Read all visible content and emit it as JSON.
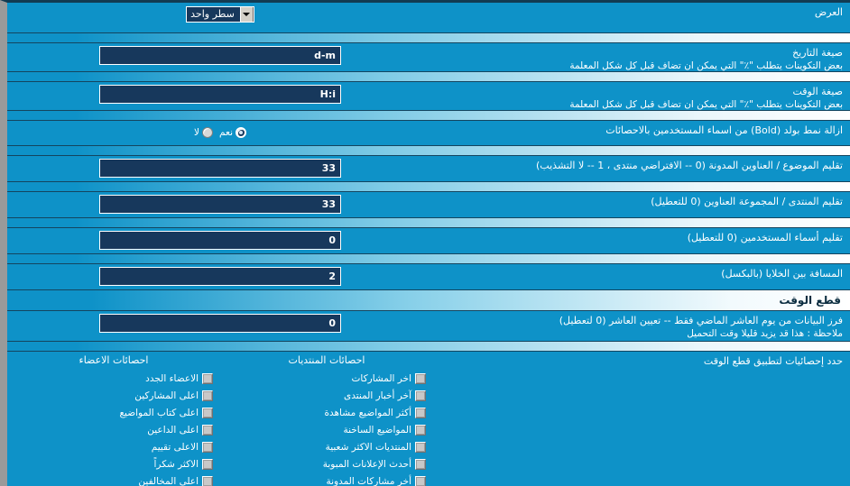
{
  "theme": {
    "body_bg": "#0e92c8",
    "input_bg": "#17385c",
    "input_border": "#ffffff",
    "divider_light": "#ffffff",
    "text": "#ffffff",
    "header_text": "#0b2d40",
    "left_border": "#9a9a9a"
  },
  "rows": [
    {
      "label": "العرض",
      "sub": "",
      "control": "select",
      "value": "سطر واحد"
    },
    {
      "label": "صيغة التاريخ",
      "sub": "بعض التكوينات يتطلب  \"٪\"  التي يمكن ان تضاف قبل كل شكل المعلمة",
      "control": "text",
      "value": "d-m"
    },
    {
      "label": "صيغة الوقت",
      "sub": "بعض التكوينات يتطلب  \"٪\"  التي يمكن ان تضاف قبل كل شكل المعلمة",
      "control": "text",
      "value": "H:i"
    },
    {
      "label": "ازالة نمط بولد (Bold) من اسماء المستخدمين بالاحصائات",
      "sub": "",
      "control": "radio",
      "value": "نعم"
    },
    {
      "label": "تقليم الموضوع / العناوين المدونة (0 -- الافتراضي منتدى ، 1 -- لا التشذيب)",
      "sub": "",
      "control": "text",
      "value": "33"
    },
    {
      "label": "تقليم المنتدى / المجموعة العناوين (0 للتعطيل)",
      "sub": "",
      "control": "text",
      "value": "33"
    },
    {
      "label": "تقليم أسماء المستخدمين (0 للتعطيل)",
      "sub": "",
      "control": "text",
      "value": "0"
    },
    {
      "label": "المسافة بين الخلايا (بالبكسل)",
      "sub": "",
      "control": "text",
      "value": "2"
    }
  ],
  "section": {
    "title": "قطع الوقت"
  },
  "cutoff_row": {
    "label": "فرز البيانات من يوم العاشر الماضي فقط -- تعيين العاشر (0 لتعطيل)",
    "sub": "ملاحظة : هذا قد يزيد قليلا وقت التحميل",
    "value": "0"
  },
  "checkbox_section": {
    "label": "حدد إحصائيات لتطبيق قطع الوقت",
    "columns": [
      {
        "header": "احصائات المنتديات",
        "items": [
          {
            "label": "اخر المشاركات",
            "checked": false
          },
          {
            "label": "آخر أخبار المنتدى",
            "checked": false
          },
          {
            "label": "أكثر المواضيع مشاهدة",
            "checked": false
          },
          {
            "label": "المواضيع الساخنة",
            "checked": false
          },
          {
            "label": "المنتديات الاكثر شعبية",
            "checked": false
          },
          {
            "label": "أحدث الإعلانات المبوبة",
            "checked": false
          },
          {
            "label": "أخر مشاركات المدونة",
            "checked": false
          }
        ]
      },
      {
        "header": "احصائات الاعضاء",
        "items": [
          {
            "label": "الاعضاء الجدد",
            "checked": false
          },
          {
            "label": "اعلى المشاركين",
            "checked": false
          },
          {
            "label": "اعلى كتاب المواضيع",
            "checked": false
          },
          {
            "label": "اعلى الداعين",
            "checked": false
          },
          {
            "label": "الاعلى تقييم",
            "checked": false
          },
          {
            "label": "الاكثر شكراً",
            "checked": false
          },
          {
            "label": "اعلى المخالفين",
            "checked": false
          }
        ]
      }
    ]
  },
  "radio_options": [
    {
      "label": "نعم",
      "selected": true
    },
    {
      "label": "لا",
      "selected": false
    }
  ],
  "icons": {
    "dropdown": "chevron-down-icon",
    "checkbox": "checkbox-icon",
    "radio": "radio-icon"
  }
}
